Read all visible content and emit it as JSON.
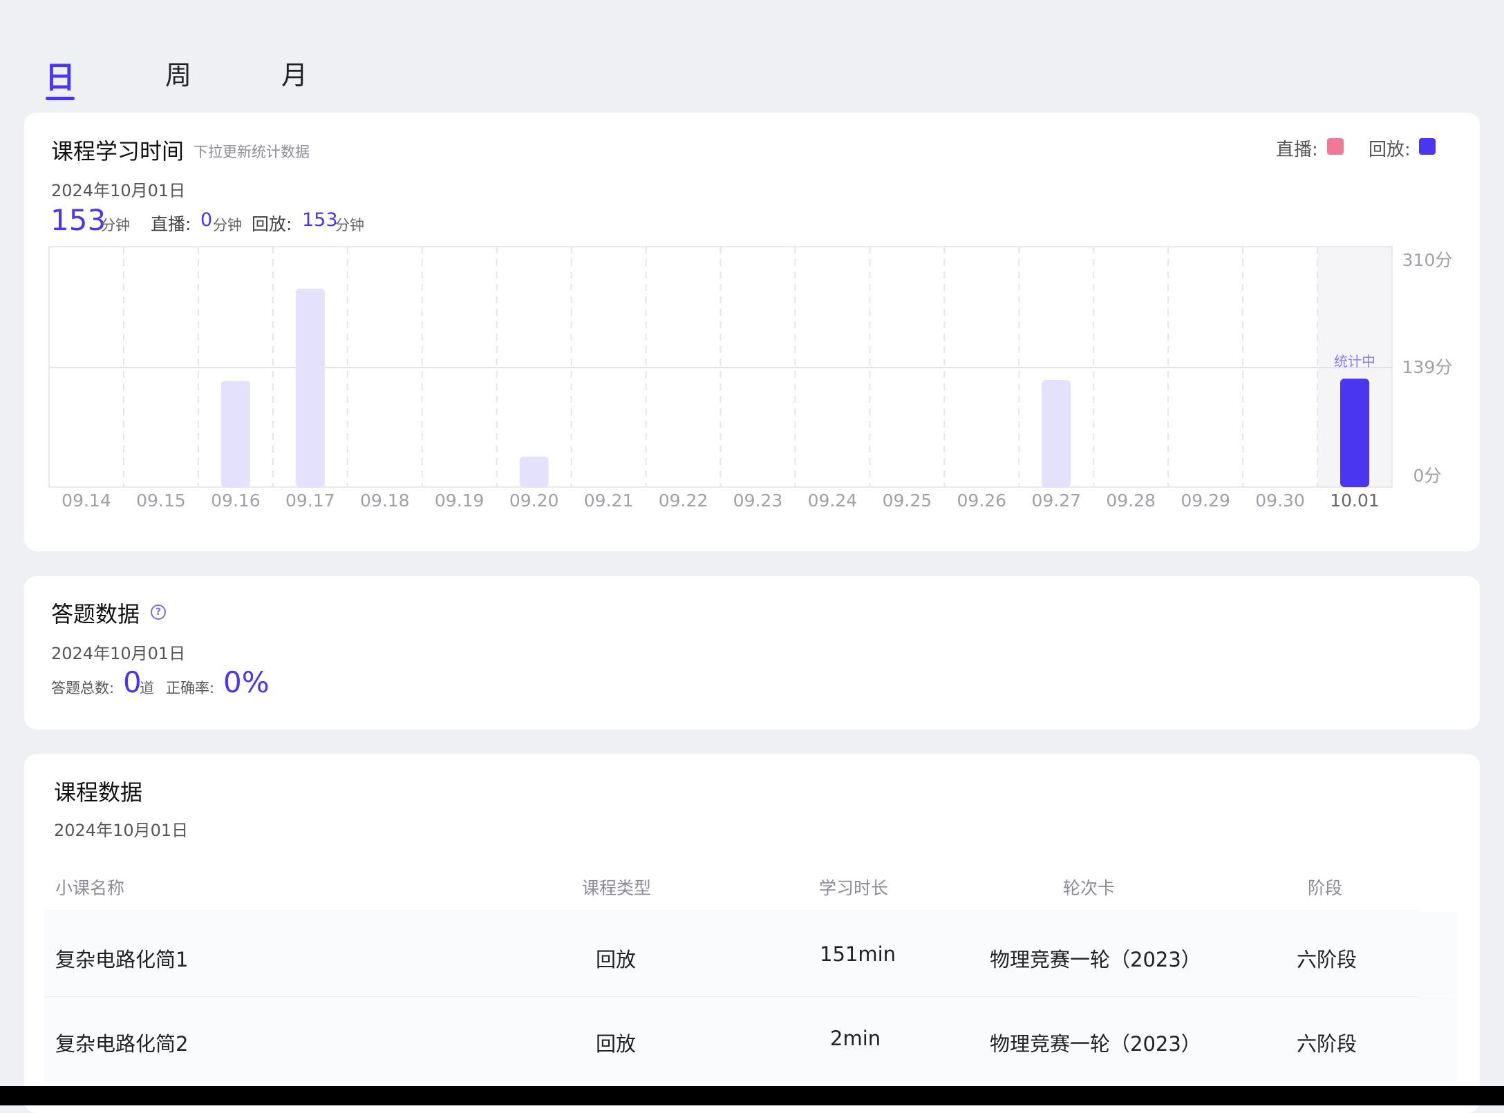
{
  "tabs": [
    {
      "label": "日",
      "active": true
    },
    {
      "label": "周",
      "active": false
    },
    {
      "label": "月",
      "active": false
    }
  ],
  "study_time": {
    "title": "课程学习时间",
    "hint": "下拉更新统计数据",
    "date": "2024年10月01日",
    "legend": {
      "live_label": "直播:",
      "replay_label": "回放:",
      "live_color": "#f07898",
      "replay_color": "#4a35f0"
    },
    "total": "153",
    "total_unit": "分钟",
    "live_label": "直播:",
    "live_value": "0",
    "live_unit": "分钟",
    "replay_label": "回放:",
    "replay_value": "153",
    "replay_unit": "分钟"
  },
  "chart_data": {
    "type": "bar",
    "categories": [
      "09.14",
      "09.15",
      "09.16",
      "09.17",
      "09.18",
      "09.19",
      "09.20",
      "09.21",
      "09.22",
      "09.23",
      "09.24",
      "09.25",
      "09.26",
      "09.27",
      "09.28",
      "09.29",
      "09.30",
      "10.01"
    ],
    "values": [
      0,
      0,
      150,
      280,
      0,
      0,
      43,
      0,
      0,
      0,
      0,
      0,
      0,
      151,
      0,
      0,
      0,
      153
    ],
    "selected_index": 17,
    "selected_label": "统计中",
    "y_ticks": [
      "310分",
      "139分",
      "0分"
    ],
    "ylim": [
      0,
      310
    ],
    "colors": {
      "bar": "#e4e1fc",
      "selected": "#4a35f0",
      "selected_bg": "#f5f5f7",
      "grid": "#e6e6e6"
    }
  },
  "answers": {
    "title": "答题数据",
    "help_icon": "question-circle-icon",
    "help_glyph": "?",
    "date": "2024年10月01日",
    "total_label": "答题总数:",
    "total_value": "0",
    "total_unit": "道",
    "accuracy_label": "正确率:",
    "accuracy_value": "0%"
  },
  "courses": {
    "title": "课程数据",
    "date": "2024年10月01日",
    "columns": [
      "小课名称",
      "课程类型",
      "学习时长",
      "轮次卡",
      "阶段"
    ],
    "rows": [
      {
        "name": "复杂电路化简1",
        "type": "回放",
        "duration": "151min",
        "round": "物理竞赛一轮（2023）",
        "stage": "六阶段"
      },
      {
        "name": "复杂电路化简2",
        "type": "回放",
        "duration": "2min",
        "round": "物理竞赛一轮（2023）",
        "stage": "六阶段"
      }
    ]
  }
}
